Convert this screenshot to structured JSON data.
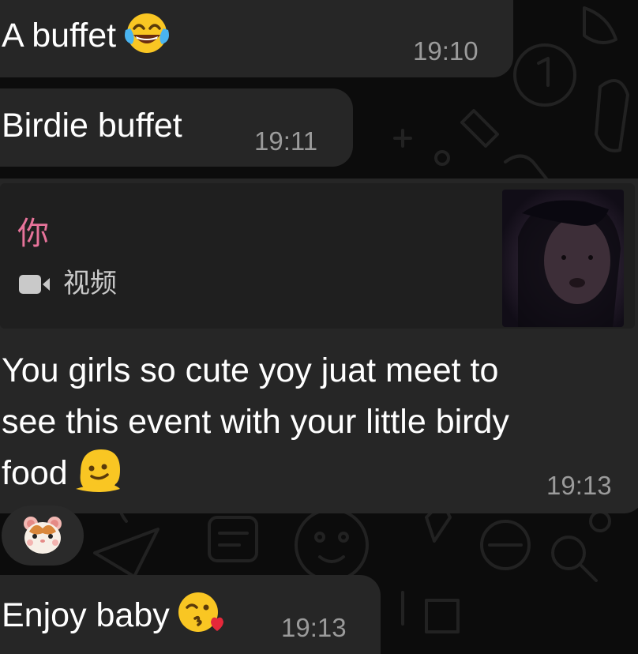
{
  "messages": [
    {
      "text": "A buffet",
      "emoji": "face-with-tears-of-joy-icon",
      "time": "19:10"
    },
    {
      "text": "Birdie buffet",
      "time": "19:11"
    },
    {
      "reply": {
        "sender": "你",
        "media_icon": "video-camera-icon",
        "media_label": "视频"
      },
      "lines": [
        "You girls so cute yoy juat meet to",
        "see this event with your little birdy",
        "food"
      ],
      "emoji": "melting-face-icon",
      "time": "19:13"
    },
    {
      "reaction": "hamster-face-icon"
    },
    {
      "text": "Enjoy baby",
      "emoji": "face-blowing-a-kiss-icon",
      "time": "19:13"
    }
  ],
  "colors": {
    "background": "#0c0c0c",
    "bubble": "#262626",
    "text": "#ffffff",
    "timestamp": "#9b9b9b",
    "reply_sender": "#e7739a",
    "reply_bar": "#1c1c1c"
  }
}
